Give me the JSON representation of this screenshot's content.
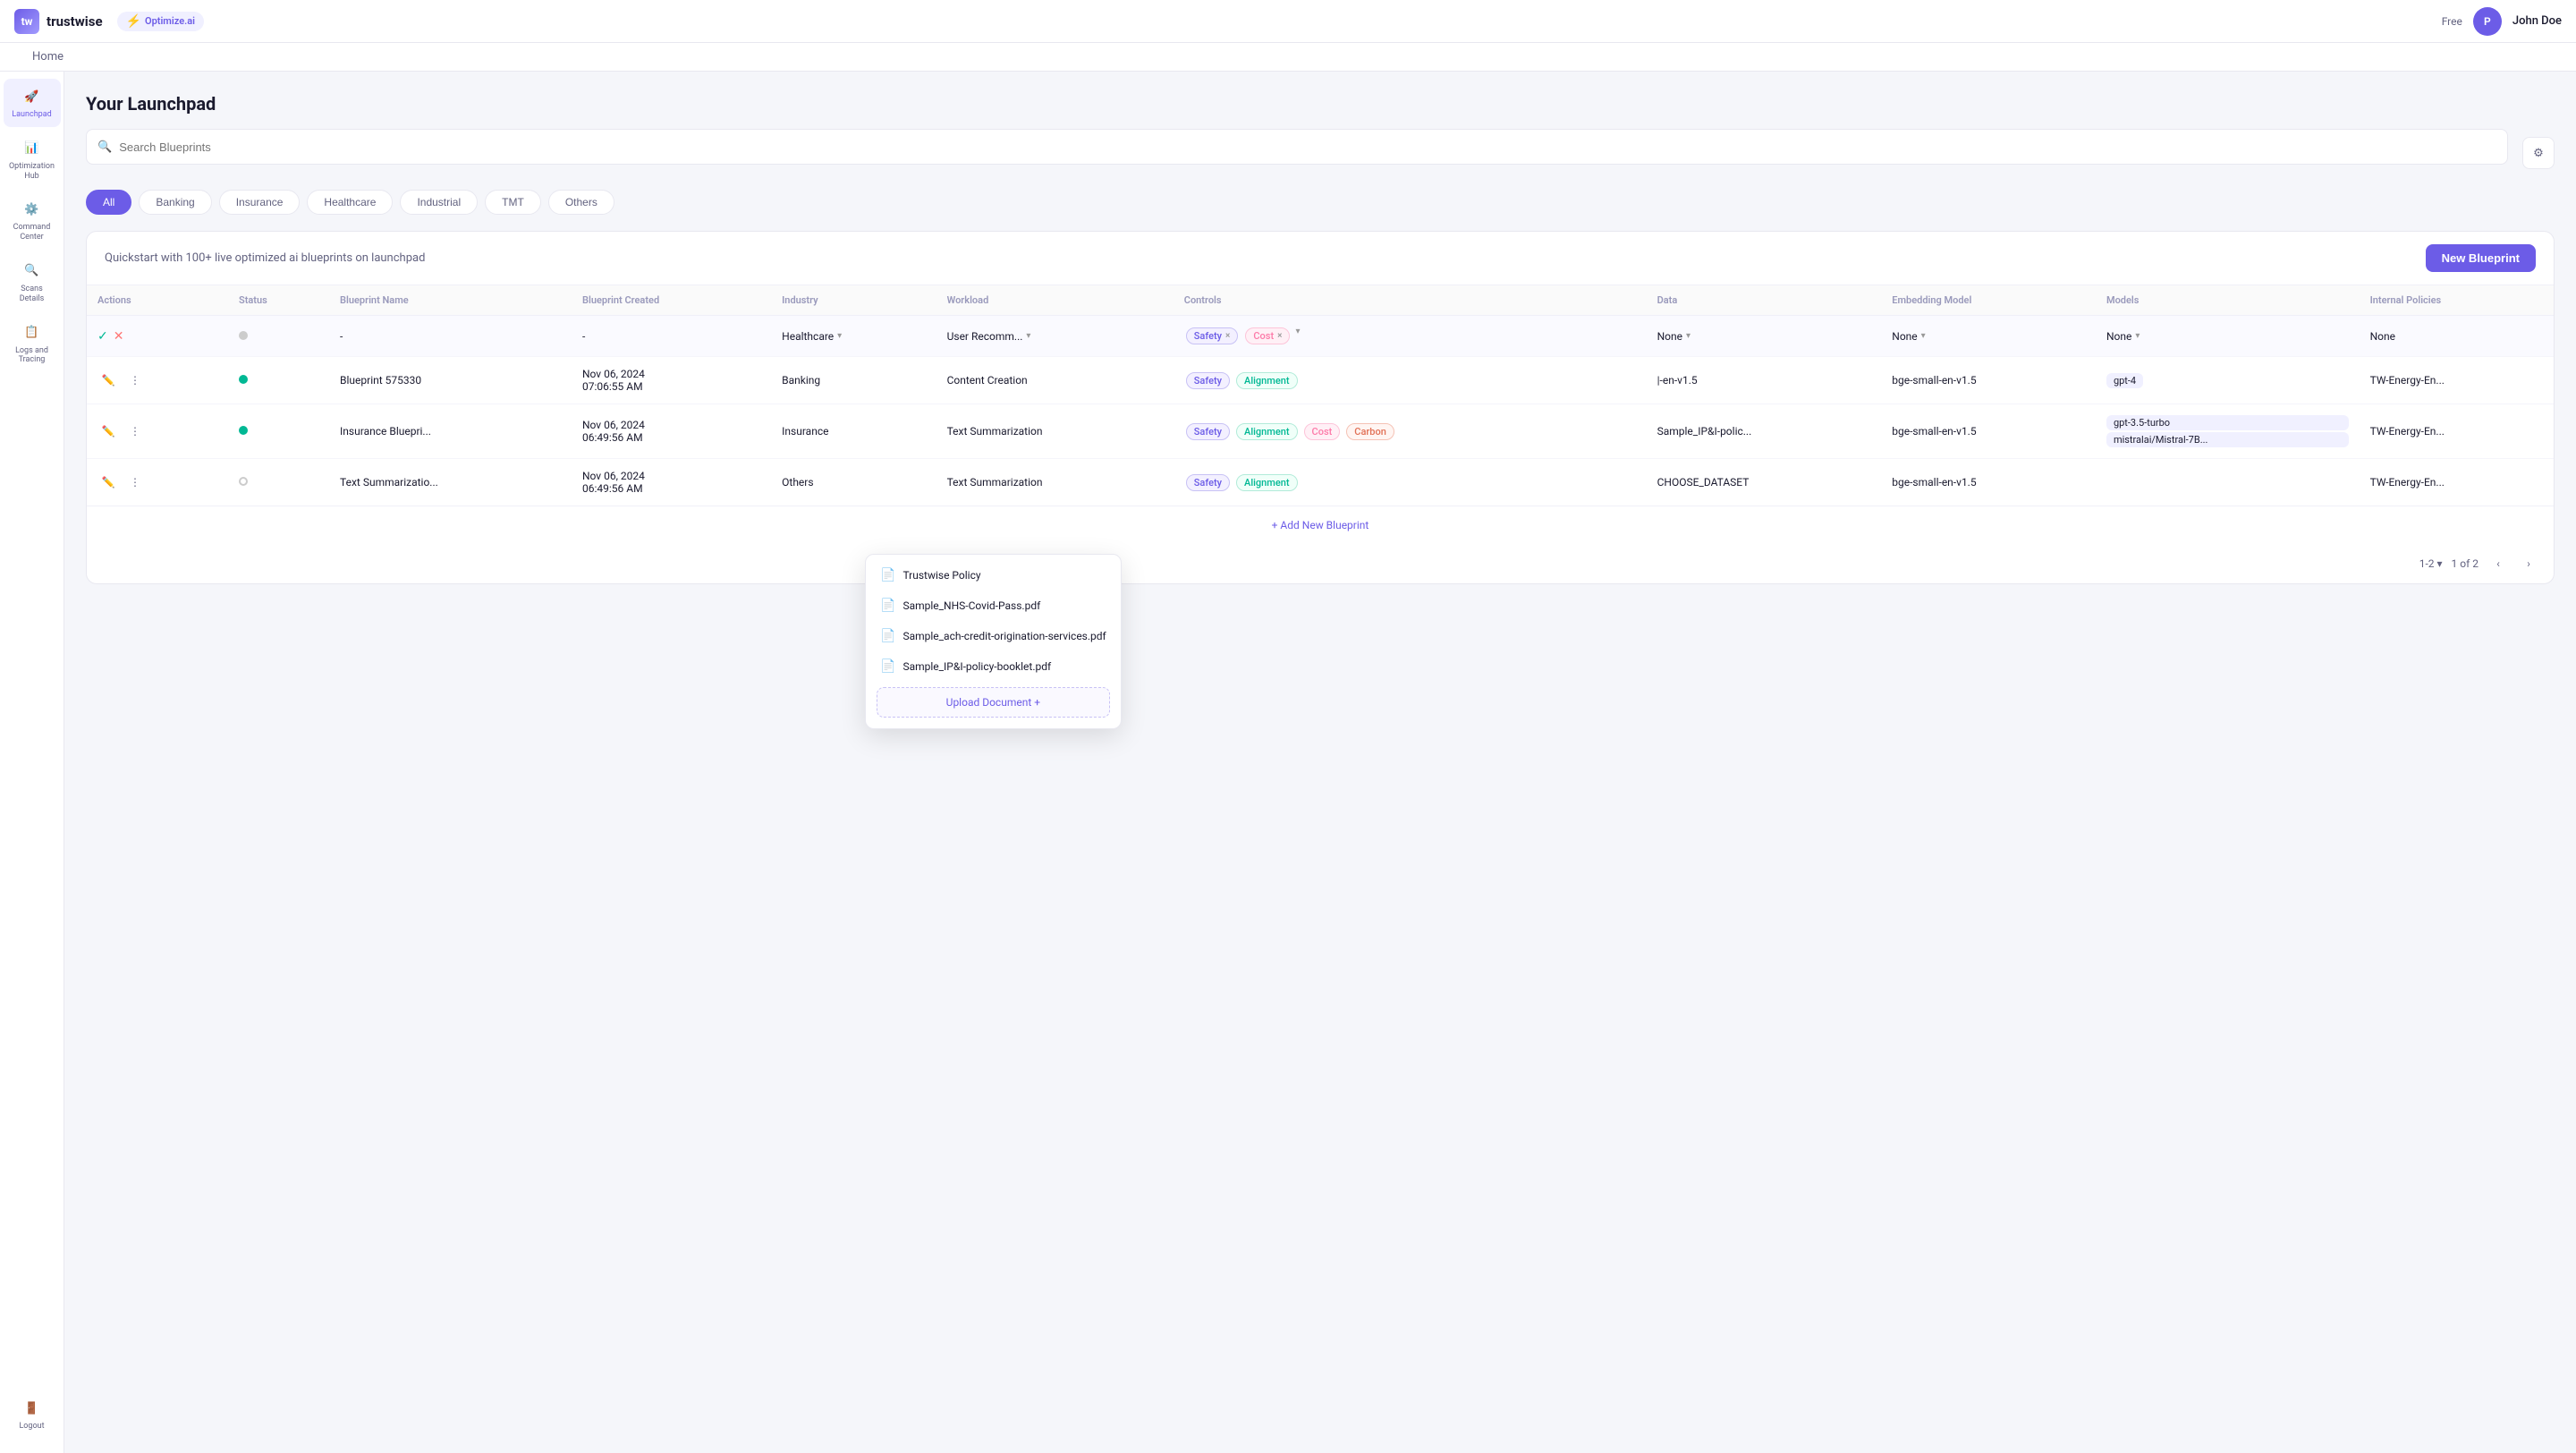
{
  "app": {
    "logo_text": "trustwise",
    "optimize_label": "Optimize.ai",
    "home_label": "Home",
    "free_label": "Free",
    "user_initial": "P",
    "user_name": "John Doe"
  },
  "sidebar": {
    "items": [
      {
        "id": "launchpad",
        "label": "Launchpad",
        "icon": "rocket",
        "active": true
      },
      {
        "id": "optimization-hub",
        "label": "Optimization Hub",
        "icon": "chart"
      },
      {
        "id": "command-center",
        "label": "Command Center",
        "icon": "grid"
      },
      {
        "id": "scans-details",
        "label": "Scans Details",
        "icon": "scan"
      },
      {
        "id": "logs-tracing",
        "label": "Logs and Tracing",
        "icon": "list"
      }
    ],
    "logout_label": "Logout"
  },
  "page": {
    "title": "Your Launchpad",
    "search_placeholder": "Search Blueprints",
    "quickstart_text": "Quickstart with 100+ live optimized ai blueprints on launchpad",
    "new_blueprint_label": "New Blueprint"
  },
  "filter_tabs": [
    {
      "id": "all",
      "label": "All",
      "active": true
    },
    {
      "id": "banking",
      "label": "Banking",
      "active": false
    },
    {
      "id": "insurance",
      "label": "Insurance",
      "active": false
    },
    {
      "id": "healthcare",
      "label": "Healthcare",
      "active": false
    },
    {
      "id": "industrial",
      "label": "Industrial",
      "active": false
    },
    {
      "id": "tmt",
      "label": "TMT",
      "active": false
    },
    {
      "id": "others",
      "label": "Others",
      "active": false
    }
  ],
  "table": {
    "columns": [
      "Actions",
      "Status",
      "Blueprint Name",
      "Blueprint Created",
      "Industry",
      "Workload",
      "Controls",
      "Data",
      "Embedding Model",
      "Models",
      "Internal Policies"
    ],
    "rows": [
      {
        "id": "editing",
        "status": "grey",
        "blueprint_name": "-",
        "blueprint_created": "-",
        "industry": "Healthcare",
        "workload": "User Recomm...",
        "controls": [
          "Safety",
          "Cost"
        ],
        "data": "None",
        "embedding_model": "None",
        "models": "None",
        "internal_policies": "None",
        "editing": true
      },
      {
        "id": "row1",
        "status": "green",
        "blueprint_name": "Blueprint 575330",
        "blueprint_created": "Nov 06, 2024 07:06:55 AM",
        "industry": "Banking",
        "workload": "Content Creation",
        "controls": [
          "Safety",
          "Alignment"
        ],
        "data": "|-en-v1.5",
        "embedding_model": "bge-small-en-v1.5",
        "models": "gpt-4",
        "internal_policies": "TW-Energy-En...",
        "editing": false
      },
      {
        "id": "row2",
        "status": "green",
        "blueprint_name": "Insurance Bluepri...",
        "blueprint_created": "Nov 06, 2024 06:49:56 AM",
        "industry": "Insurance",
        "workload": "Text Summarization",
        "controls": [
          "Safety",
          "Alignment",
          "Cost",
          "Carbon"
        ],
        "data": "Sample_IP&I-polic...",
        "embedding_model": "bge-small-en-v1.5",
        "models": "gpt-3.5-turbo",
        "models2": "mistralai/Mistral-7B...",
        "internal_policies": "TW-Energy-En...",
        "editing": false
      },
      {
        "id": "row3",
        "status": "outline",
        "blueprint_name": "Text Summarizatio...",
        "blueprint_created": "Nov 06, 2024 06:49:56 AM",
        "industry": "Others",
        "workload": "Text Summarization",
        "controls": [
          "Safety",
          "Alignment"
        ],
        "data": "CHOOSE_DATASET",
        "embedding_model": "bge-small-en-v1.5",
        "models": "",
        "internal_policies": "TW-Energy-En...",
        "editing": false
      }
    ]
  },
  "dropdown": {
    "items": [
      {
        "id": "trustwise-policy",
        "label": "Trustwise Policy",
        "icon": "doc"
      },
      {
        "id": "sample-nhs",
        "label": "Sample_NHS-Covid-Pass.pdf",
        "icon": "pdf"
      },
      {
        "id": "sample-ach",
        "label": "Sample_ach-credit-origination-services.pdf",
        "icon": "pdf"
      },
      {
        "id": "sample-ipi",
        "label": "Sample_IP&I-policy-booklet.pdf",
        "icon": "pdf"
      }
    ],
    "upload_label": "Upload Document +"
  },
  "pagination": {
    "range": "1-2",
    "total": "1 of 2"
  },
  "add_row_label": "+ Add New Blueprint"
}
